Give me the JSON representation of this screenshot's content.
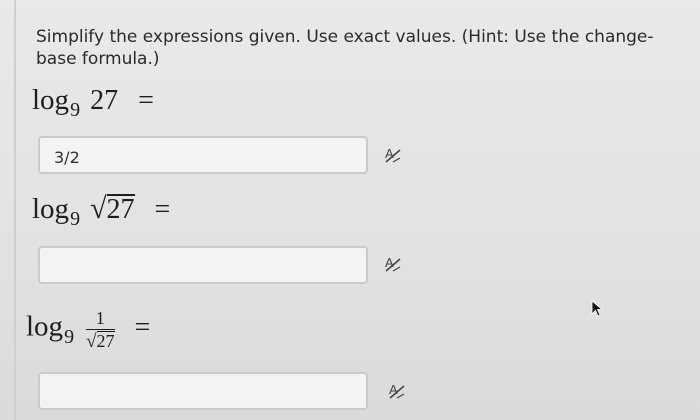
{
  "instructions": "Simplify the expressions given. Use exact values. (Hint: Use the change-base formula.)",
  "questions": [
    {
      "log": "log",
      "base": "9",
      "argument": "27",
      "equals": "=",
      "answer_value": "3/2"
    },
    {
      "log": "log",
      "base": "9",
      "radical": "√",
      "radicand": "27",
      "equals": "=",
      "answer_value": ""
    },
    {
      "log": "log",
      "base": "9",
      "numerator": "1",
      "radical": "√",
      "denominator_radicand": "27",
      "equals": "=",
      "answer_value": ""
    }
  ],
  "icons": {
    "preview": "equation-preview-icon",
    "cursor": "mouse-pointer-icon"
  }
}
